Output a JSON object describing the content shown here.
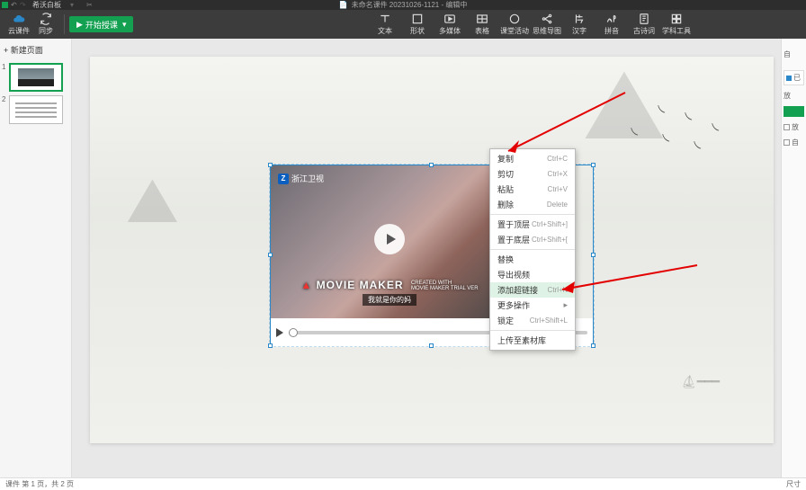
{
  "title": "未命名课件 20231026-1121 - 编辑中",
  "menu": {
    "file": "希沃白板"
  },
  "topbar": {
    "cloud": "云课件",
    "sync": "同步",
    "start": "开始授课",
    "tools": [
      "文本",
      "形状",
      "多媒体",
      "表格",
      "课堂活动",
      "思维导图",
      "汉字",
      "拼音",
      "古诗词",
      "学科工具"
    ]
  },
  "sidepanel": {
    "add": "+ 新建页面",
    "nums": [
      "1",
      "2"
    ]
  },
  "video": {
    "channel": "浙江卫视",
    "maker": "MOVIE MAKER",
    "sub1": "CREATED WITH",
    "sub2": "MOVIE MAKER TRIAL VER",
    "strap": "我就是你的妈"
  },
  "ctx": {
    "copy": {
      "l": "复制",
      "s": "Ctrl+C"
    },
    "cut": {
      "l": "剪切",
      "s": "Ctrl+X"
    },
    "paste": {
      "l": "粘贴",
      "s": "Ctrl+V"
    },
    "delete": {
      "l": "删除",
      "s": "Delete"
    },
    "top": {
      "l": "置于顶层",
      "s": "Ctrl+Shift+]"
    },
    "bottom": {
      "l": "置于底层",
      "s": "Ctrl+Shift+["
    },
    "replace": {
      "l": "替换"
    },
    "export": {
      "l": "导出视频"
    },
    "addlink": {
      "l": "添加超链接",
      "s": "Ctrl+K"
    },
    "more": {
      "l": "更多操作"
    },
    "lock": {
      "l": "锁定",
      "s": "Ctrl+Shift+L"
    },
    "upload": {
      "l": "上传至素材库"
    }
  },
  "right": {
    "tab": "已",
    "r1": "自",
    "r2": "放",
    "r3": "自"
  },
  "status": {
    "left": "课件 第 1 页，共 2 页",
    "right": "尺寸"
  }
}
